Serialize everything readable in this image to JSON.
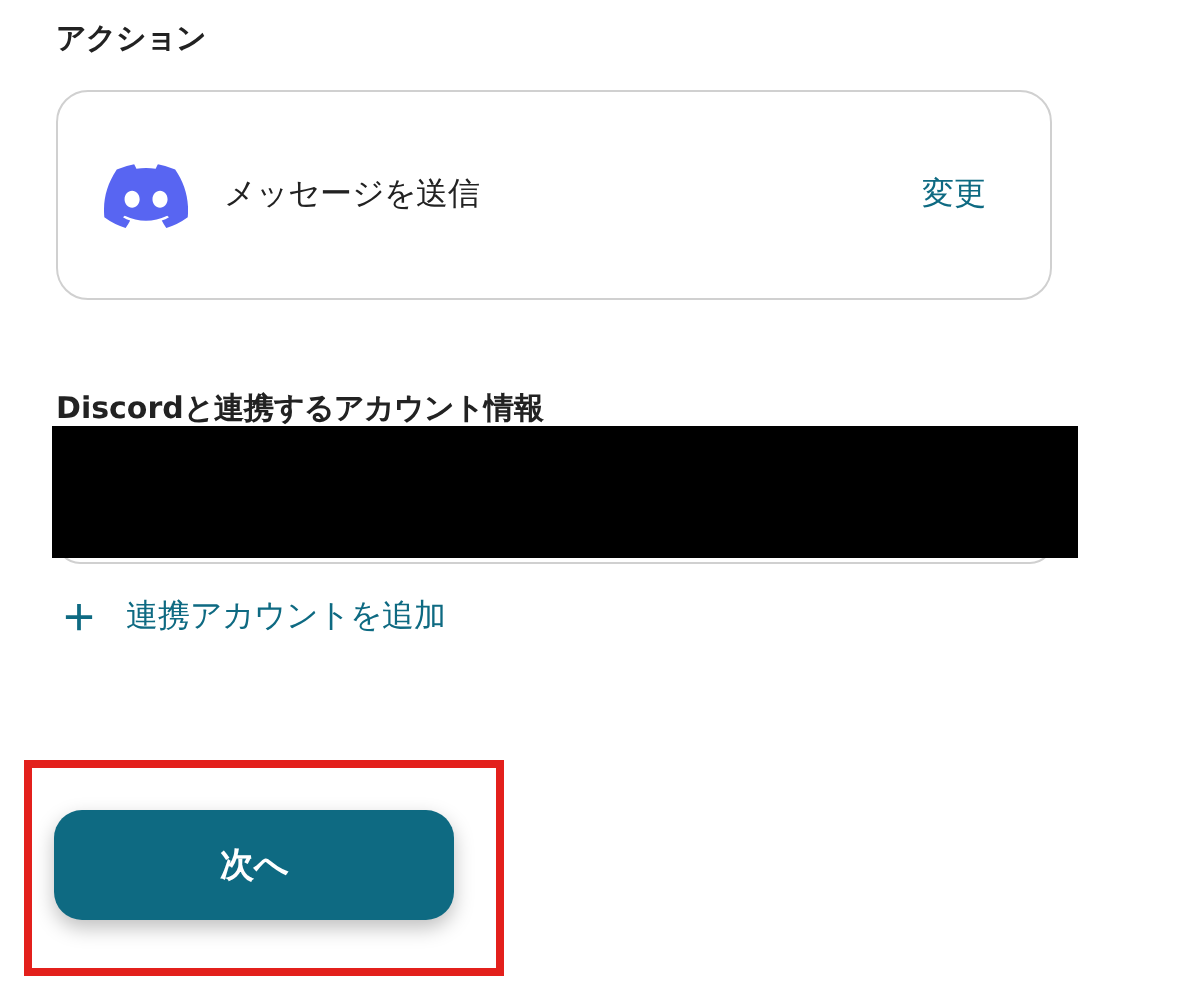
{
  "action_section": {
    "heading": "アクション",
    "action": {
      "label": "メッセージを送信",
      "change_link": "変更"
    }
  },
  "account_section": {
    "label": "Discordと連携するアカウント情報",
    "add_link": "連携アカウントを追加"
  },
  "next_button": "次へ"
}
